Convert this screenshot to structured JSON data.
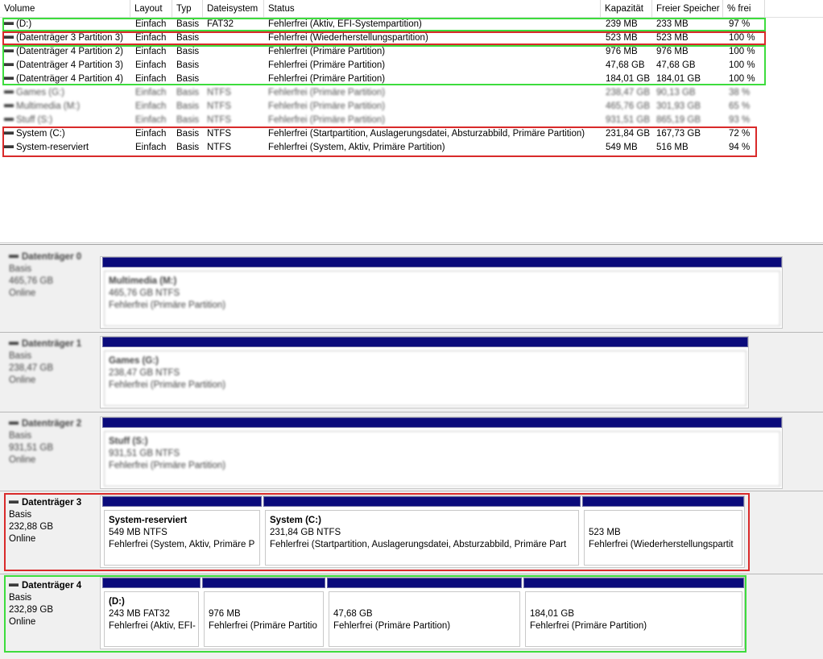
{
  "columns": [
    "Volume",
    "Layout",
    "Typ",
    "Dateisystem",
    "Status",
    "Kapazität",
    "Freier Speicher",
    "% frei"
  ],
  "volumes": [
    {
      "name": "(D:)",
      "layout": "Einfach",
      "type": "Basis",
      "fs": "FAT32",
      "status": "Fehlerfrei (Aktiv, EFI-Systempartition)",
      "capacity": "239 MB",
      "free": "233 MB",
      "pct": "97 %"
    },
    {
      "name": "(Datenträger 3 Partition 3)",
      "layout": "Einfach",
      "type": "Basis",
      "fs": "",
      "status": "Fehlerfrei (Wiederherstellungspartition)",
      "capacity": "523 MB",
      "free": "523 MB",
      "pct": "100 %"
    },
    {
      "name": "(Datenträger 4 Partition 2)",
      "layout": "Einfach",
      "type": "Basis",
      "fs": "",
      "status": "Fehlerfrei (Primäre Partition)",
      "capacity": "976 MB",
      "free": "976 MB",
      "pct": "100 %"
    },
    {
      "name": "(Datenträger 4 Partition 3)",
      "layout": "Einfach",
      "type": "Basis",
      "fs": "",
      "status": "Fehlerfrei (Primäre Partition)",
      "capacity": "47,68 GB",
      "free": "47,68 GB",
      "pct": "100 %"
    },
    {
      "name": "(Datenträger 4 Partition 4)",
      "layout": "Einfach",
      "type": "Basis",
      "fs": "",
      "status": "Fehlerfrei (Primäre Partition)",
      "capacity": "184,01 GB",
      "free": "184,01 GB",
      "pct": "100 %"
    },
    {
      "name": "Games (G:)",
      "layout": "Einfach",
      "type": "Basis",
      "fs": "NTFS",
      "status": "Fehlerfrei (Primäre Partition)",
      "capacity": "238,47 GB",
      "free": "90,13 GB",
      "pct": "38 %",
      "blur": true
    },
    {
      "name": "Multimedia (M:)",
      "layout": "Einfach",
      "type": "Basis",
      "fs": "NTFS",
      "status": "Fehlerfrei (Primäre Partition)",
      "capacity": "465,76 GB",
      "free": "301,93 GB",
      "pct": "65 %",
      "blur": true
    },
    {
      "name": "Stuff (S:)",
      "layout": "Einfach",
      "type": "Basis",
      "fs": "NTFS",
      "status": "Fehlerfrei (Primäre Partition)",
      "capacity": "931,51 GB",
      "free": "865,19 GB",
      "pct": "93 %",
      "blur": true
    },
    {
      "name": "System (C:)",
      "layout": "Einfach",
      "type": "Basis",
      "fs": "NTFS",
      "status": "Fehlerfrei (Startpartition, Auslagerungsdatei, Absturzabbild, Primäre Partition)",
      "capacity": "231,84 GB",
      "free": "167,73 GB",
      "pct": "72 %"
    },
    {
      "name": "System-reserviert",
      "layout": "Einfach",
      "type": "Basis",
      "fs": "NTFS",
      "status": "Fehlerfrei (System, Aktiv, Primäre Partition)",
      "capacity": "549 MB",
      "free": "516 MB",
      "pct": "94 %"
    }
  ],
  "disks": [
    {
      "name": "Datenträger 0",
      "type": "Basis",
      "size": "465,76 GB",
      "state": "Online",
      "blur": true,
      "partitions": [
        {
          "title": "Multimedia (M:)",
          "size_fs": "465,76 GB NTFS",
          "status": "Fehlerfrei (Primäre Partition)"
        }
      ]
    },
    {
      "name": "Datenträger 1",
      "type": "Basis",
      "size": "238,47 GB",
      "state": "Online",
      "blur": true,
      "partitions": [
        {
          "title": "Games (G:)",
          "size_fs": "238,47 GB NTFS",
          "status": "Fehlerfrei (Primäre Partition)"
        }
      ]
    },
    {
      "name": "Datenträger 2",
      "type": "Basis",
      "size": "931,51 GB",
      "state": "Online",
      "blur": true,
      "partitions": [
        {
          "title": "Stuff (S:)",
          "size_fs": "931,51 GB NTFS",
          "status": "Fehlerfrei (Primäre Partition)"
        }
      ]
    },
    {
      "name": "Datenträger 3",
      "type": "Basis",
      "size": "232,88 GB",
      "state": "Online",
      "partitions": [
        {
          "title": "System-reserviert",
          "size_fs": "549 MB NTFS",
          "status": "Fehlerfrei (System, Aktiv, Primäre P"
        },
        {
          "title": "System  (C:)",
          "size_fs": "231,84 GB NTFS",
          "status": "Fehlerfrei (Startpartition, Auslagerungsdatei, Absturzabbild, Primäre Part"
        },
        {
          "title": "",
          "size_fs": "523 MB",
          "status": "Fehlerfrei (Wiederherstellungspartit"
        }
      ]
    },
    {
      "name": "Datenträger 4",
      "type": "Basis",
      "size": "232,89 GB",
      "state": "Online",
      "partitions": [
        {
          "title": "(D:)",
          "size_fs": "243 MB FAT32",
          "status": "Fehlerfrei (Aktiv, EFI-"
        },
        {
          "title": "",
          "size_fs": "976 MB",
          "status": "Fehlerfrei (Primäre Partitio"
        },
        {
          "title": "",
          "size_fs": "47,68 GB",
          "status": "Fehlerfrei (Primäre Partition)"
        },
        {
          "title": "",
          "size_fs": "184,01 GB",
          "status": "Fehlerfrei (Primäre Partition)"
        }
      ]
    }
  ],
  "highlight_colors": {
    "green": "#3ddc3d",
    "red": "#d92a2a",
    "partition_bar": "#0b0b7c"
  }
}
